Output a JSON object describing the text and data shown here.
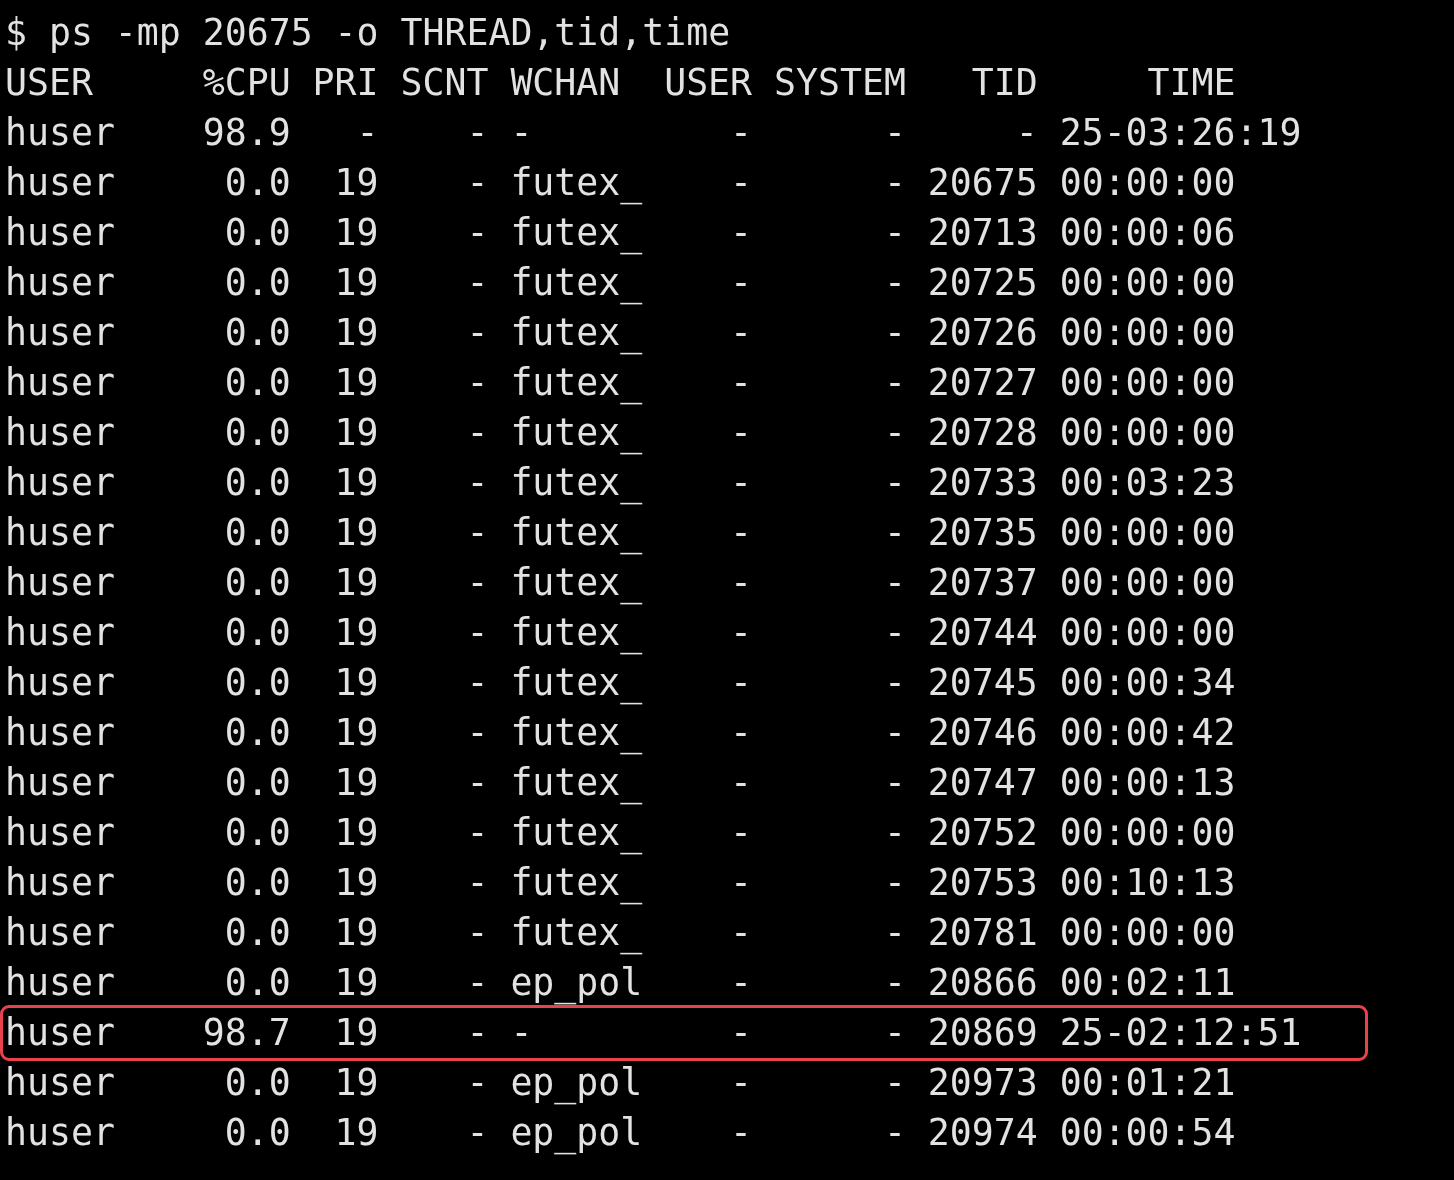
{
  "terminal": {
    "command": "$ ps -mp 20675 -o THREAD,tid,time",
    "columns": [
      "USER",
      "%CPU",
      "PRI",
      "SCNT",
      "WCHAN",
      "USER",
      "SYSTEM",
      "TID",
      "TIME"
    ],
    "rows": [
      {
        "cells": [
          "huser",
          "98.9",
          "-",
          "-",
          "-",
          "-",
          "-",
          "-",
          "25-03:26:19"
        ],
        "highlighted": false
      },
      {
        "cells": [
          "huser",
          "0.0",
          "19",
          "-",
          "futex_",
          "-",
          "-",
          "20675",
          "00:00:00"
        ],
        "highlighted": false
      },
      {
        "cells": [
          "huser",
          "0.0",
          "19",
          "-",
          "futex_",
          "-",
          "-",
          "20713",
          "00:00:06"
        ],
        "highlighted": false
      },
      {
        "cells": [
          "huser",
          "0.0",
          "19",
          "-",
          "futex_",
          "-",
          "-",
          "20725",
          "00:00:00"
        ],
        "highlighted": false
      },
      {
        "cells": [
          "huser",
          "0.0",
          "19",
          "-",
          "futex_",
          "-",
          "-",
          "20726",
          "00:00:00"
        ],
        "highlighted": false
      },
      {
        "cells": [
          "huser",
          "0.0",
          "19",
          "-",
          "futex_",
          "-",
          "-",
          "20727",
          "00:00:00"
        ],
        "highlighted": false
      },
      {
        "cells": [
          "huser",
          "0.0",
          "19",
          "-",
          "futex_",
          "-",
          "-",
          "20728",
          "00:00:00"
        ],
        "highlighted": false
      },
      {
        "cells": [
          "huser",
          "0.0",
          "19",
          "-",
          "futex_",
          "-",
          "-",
          "20733",
          "00:03:23"
        ],
        "highlighted": false
      },
      {
        "cells": [
          "huser",
          "0.0",
          "19",
          "-",
          "futex_",
          "-",
          "-",
          "20735",
          "00:00:00"
        ],
        "highlighted": false
      },
      {
        "cells": [
          "huser",
          "0.0",
          "19",
          "-",
          "futex_",
          "-",
          "-",
          "20737",
          "00:00:00"
        ],
        "highlighted": false
      },
      {
        "cells": [
          "huser",
          "0.0",
          "19",
          "-",
          "futex_",
          "-",
          "-",
          "20744",
          "00:00:00"
        ],
        "highlighted": false
      },
      {
        "cells": [
          "huser",
          "0.0",
          "19",
          "-",
          "futex_",
          "-",
          "-",
          "20745",
          "00:00:34"
        ],
        "highlighted": false
      },
      {
        "cells": [
          "huser",
          "0.0",
          "19",
          "-",
          "futex_",
          "-",
          "-",
          "20746",
          "00:00:42"
        ],
        "highlighted": false
      },
      {
        "cells": [
          "huser",
          "0.0",
          "19",
          "-",
          "futex_",
          "-",
          "-",
          "20747",
          "00:00:13"
        ],
        "highlighted": false
      },
      {
        "cells": [
          "huser",
          "0.0",
          "19",
          "-",
          "futex_",
          "-",
          "-",
          "20752",
          "00:00:00"
        ],
        "highlighted": false
      },
      {
        "cells": [
          "huser",
          "0.0",
          "19",
          "-",
          "futex_",
          "-",
          "-",
          "20753",
          "00:10:13"
        ],
        "highlighted": false
      },
      {
        "cells": [
          "huser",
          "0.0",
          "19",
          "-",
          "futex_",
          "-",
          "-",
          "20781",
          "00:00:00"
        ],
        "highlighted": false
      },
      {
        "cells": [
          "huser",
          "0.0",
          "19",
          "-",
          "ep_pol",
          "-",
          "-",
          "20866",
          "00:02:11"
        ],
        "highlighted": false
      },
      {
        "cells": [
          "huser",
          "98.7",
          "19",
          "-",
          "-",
          "-",
          "-",
          "20869",
          "25-02:12:51"
        ],
        "highlighted": true
      },
      {
        "cells": [
          "huser",
          "0.0",
          "19",
          "-",
          "ep_pol",
          "-",
          "-",
          "20973",
          "00:01:21"
        ],
        "highlighted": false
      },
      {
        "cells": [
          "huser",
          "0.0",
          "19",
          "-",
          "ep_pol",
          "-",
          "-",
          "20974",
          "00:00:54"
        ],
        "highlighted": false
      }
    ]
  }
}
